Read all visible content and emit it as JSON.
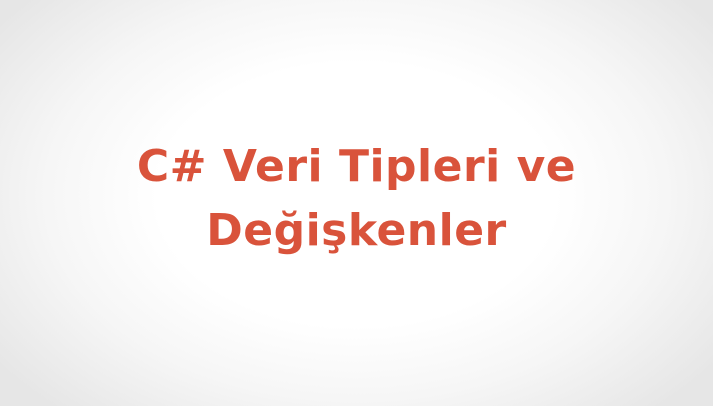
{
  "slide": {
    "title_lines": [
      "C# Veri Tipleri ve",
      "Değişkenler"
    ],
    "title_color": "#d9533b",
    "background_color": "#ffffff"
  }
}
